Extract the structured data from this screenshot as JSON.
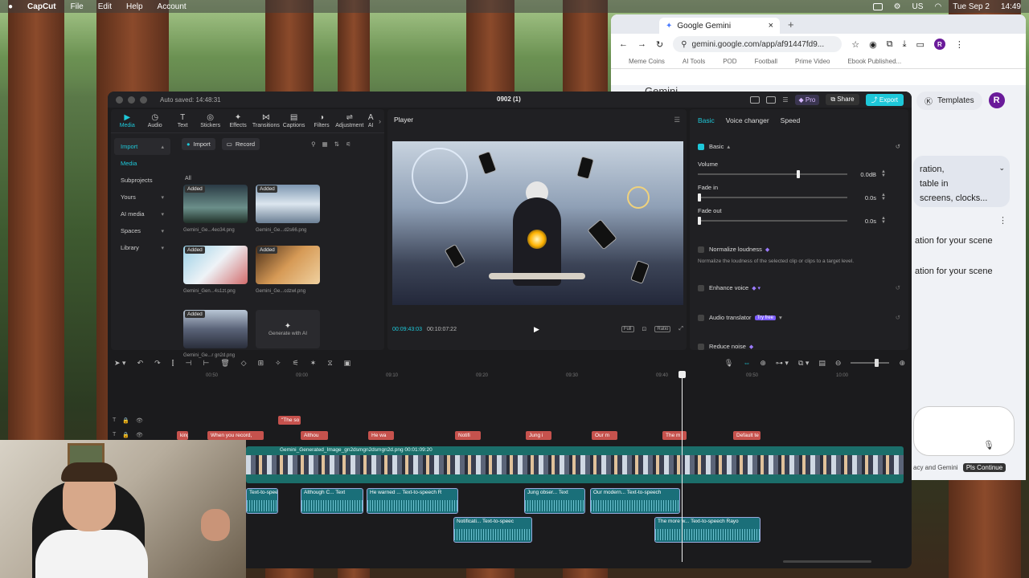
{
  "menubar": {
    "app": "CapCut",
    "items": [
      "File",
      "Edit",
      "Help",
      "Account"
    ],
    "right_items": [
      "US",
      "Tue Sep 2",
      "14:49"
    ]
  },
  "chrome": {
    "tab_title": "Google Gemini",
    "url": "gemini.google.com/app/af91447fd9...",
    "bookmarks": [
      "Meme Coins",
      "AI Tools",
      "POD",
      "Football",
      "Prime Video",
      "Ebook Published..."
    ],
    "app_name": "Gemini",
    "templates_label": "Templates",
    "avatar_letter": "R",
    "card_lines": [
      "ration,",
      "table in",
      "screens, clocks..."
    ],
    "lines": [
      "ation for your scene",
      "ation for your scene"
    ],
    "footer": "acy and Gemini",
    "footer_btn": "Pls Continue"
  },
  "capcut": {
    "autosave": "Auto saved: 14:48:31",
    "project_title": "0902 (1)",
    "pro_label": "Pro",
    "share_label": "Share",
    "export_label": "Export",
    "tools": [
      {
        "label": "Media",
        "icon": "▶"
      },
      {
        "label": "Audio",
        "icon": "◷"
      },
      {
        "label": "Text",
        "icon": "T"
      },
      {
        "label": "Stickers",
        "icon": "◎"
      },
      {
        "label": "Effects",
        "icon": "✦"
      },
      {
        "label": "Transitions",
        "icon": "⋈"
      },
      {
        "label": "Captions",
        "icon": "▤"
      },
      {
        "label": "Filters",
        "icon": "◑"
      },
      {
        "label": "Adjustment",
        "icon": "⇌"
      },
      {
        "label": "AI",
        "icon": "A"
      }
    ],
    "side_menu": [
      {
        "label": "Import",
        "chev": "▴"
      },
      {
        "label": "Media",
        "chev": ""
      },
      {
        "label": "Subprojects",
        "chev": ""
      },
      {
        "label": "Yours",
        "chev": "▾"
      },
      {
        "label": "AI media",
        "chev": "▾"
      },
      {
        "label": "Spaces",
        "chev": "▾"
      },
      {
        "label": "Library",
        "chev": "▾"
      }
    ],
    "import_btn": "Import",
    "record_btn": "Record",
    "all_label": "All",
    "thumbs": [
      {
        "badge": "Added",
        "name": "Gemini_Ge...4eo34.png"
      },
      {
        "badge": "Added",
        "name": "Gemini_Ge...d2s66.png"
      },
      {
        "badge": "Added",
        "name": "Gemini_Gen...4s1zt.png"
      },
      {
        "badge": "Added",
        "name": "Gemini_Ge...cdzwl.png"
      },
      {
        "badge": "Added",
        "name": "Gemini_Ge...r gn2d.png"
      }
    ],
    "generate_ai": "Generate with AI",
    "player": {
      "title": "Player",
      "current_time": "00:09:43:03",
      "duration": "00:10:07:22",
      "full_label": "Full",
      "ratio_label": "Ratio"
    },
    "inspector": {
      "tabs": [
        "Basic",
        "Voice changer",
        "Speed"
      ],
      "basic_label": "Basic",
      "volume_label": "Volume",
      "volume_value": "0.0dB",
      "volume_level": 0.66,
      "fadein_label": "Fade in",
      "fadein_value": "0.0s",
      "fadeout_label": "Fade out",
      "fadeout_value": "0.0s",
      "normalize_label": "Normalize loudness",
      "normalize_desc": "Normalize the loudness of the selected clip or clips to a target level.",
      "enhance_label": "Enhance voice",
      "translator_label": "Audio translator",
      "tryfree": "Try free",
      "reduce_label": "Reduce noise"
    },
    "ruler": [
      "00:50",
      "09:00",
      "09:10",
      "09:20",
      "09:30",
      "09:40",
      "09:50",
      "10:00"
    ],
    "text_track_top": [
      "\"The so"
    ],
    "text_track": [
      "king",
      "When you record,",
      "Althou",
      "He wa",
      "Notifi",
      "Jung i",
      "Our m",
      "The m",
      "Default te"
    ],
    "video_label": "Gemini_Generated_Image_gn2dsmgn2dsmgn2d.png  00:01:09:20",
    "audio_row1": [
      {
        "label": "Text-to-spee"
      },
      {
        "label": "Although C...  Text"
      },
      {
        "label": "He warned ...  Text-to-speech R"
      },
      {
        "label": "Jung obser...  Text"
      },
      {
        "label": "Our modern...  Text-to-speech"
      }
    ],
    "audio_row2": [
      {
        "label": "Notificati...   Text-to-speec"
      },
      {
        "label": "The more w...   Text-to-speech Rayo"
      }
    ]
  }
}
